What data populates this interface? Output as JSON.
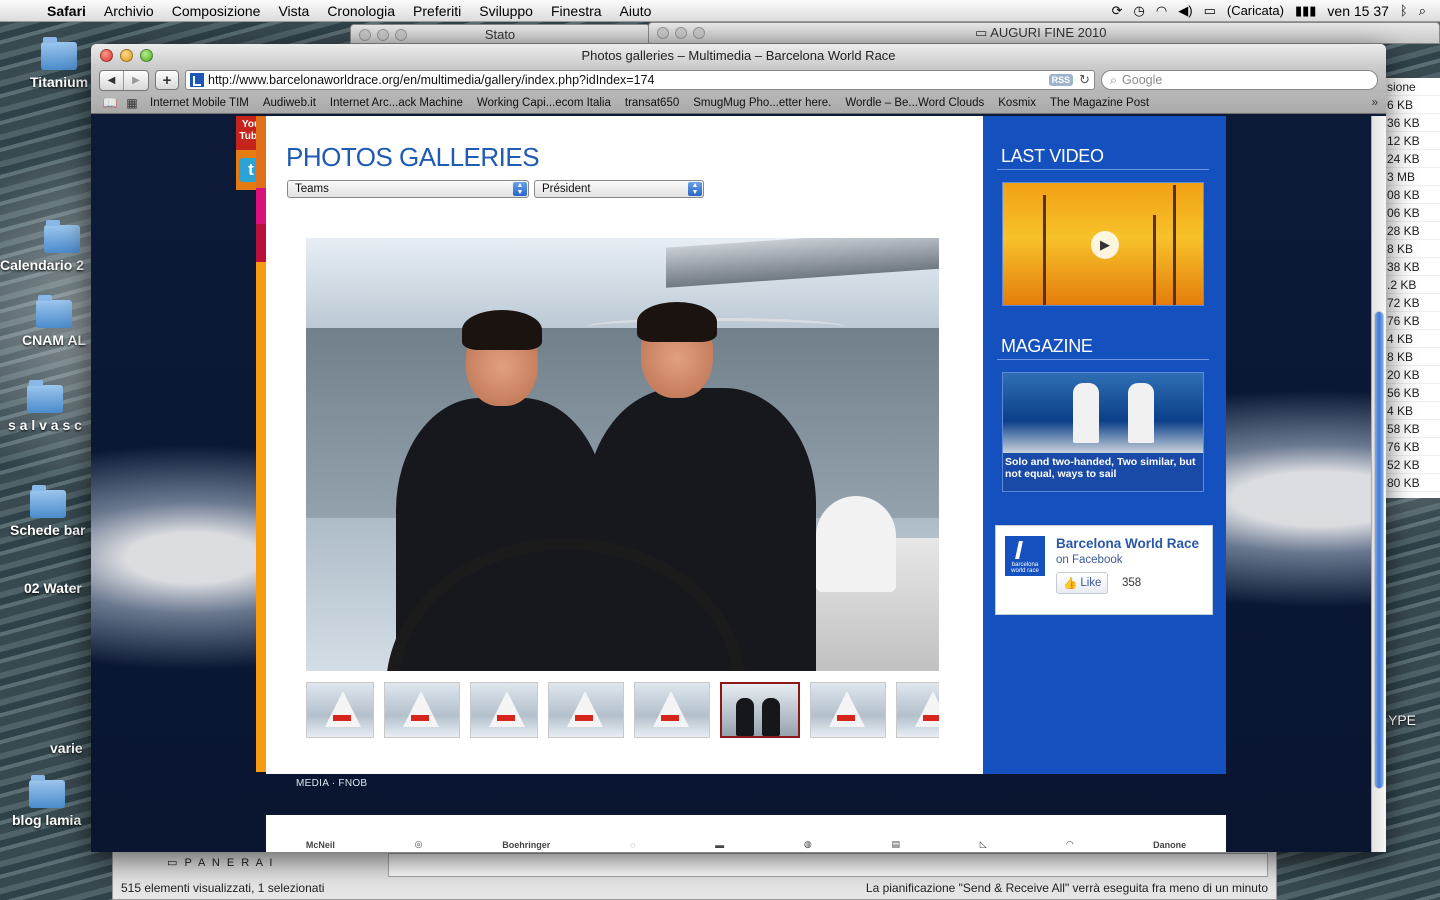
{
  "menubar": {
    "app": "Safari",
    "items": [
      "Archivio",
      "Composizione",
      "Vista",
      "Cronologia",
      "Preferiti",
      "Sviluppo",
      "Finestra",
      "Aiuto"
    ],
    "battery": "(Caricata)",
    "clock": "ven 15 37"
  },
  "desktop": {
    "icons": [
      "Titanium",
      "Calendario 2",
      "CNAM AL",
      "s a l v a s c",
      "Schede bar",
      "02 Water",
      "varie",
      "blog lamia"
    ]
  },
  "bg_windows": {
    "status_title": "Stato",
    "auguri_title": "AUGURI FINE 2010",
    "right_list_header": "sione",
    "right_list": [
      "6 KB",
      "36 KB",
      "12 KB",
      "24 KB",
      "3 MB",
      "08 KB",
      "06 KB",
      "28 KB",
      "8 KB",
      "38 KB",
      ".2 KB",
      "72 KB",
      "76 KB",
      "4 KB",
      "8 KB",
      "20 KB",
      "56 KB",
      "4 KB",
      "58 KB",
      "76 KB",
      "52 KB",
      "80 KB"
    ],
    "right_label": "YPE",
    "mail_folder": "P A N E R A I",
    "mail_status_left": "515 elementi visualizzati, 1 selezionati",
    "mail_status_right": "La pianificazione \"Send & Receive All\" verrà eseguita fra meno di un minuto"
  },
  "safari": {
    "title": "Photos galleries – Multimedia – Barcelona World Race",
    "url": "http://www.barcelonaworldrace.org/en/multimedia/gallery/index.php?idIndex=174",
    "rss": "RSS",
    "search_placeholder": "Google",
    "bookmarks": [
      "Internet Mobile TIM",
      "Audiweb.it",
      "Internet Arc...ack Machine",
      "Working Capi...ecom Italia",
      "transat650",
      "SmugMug Pho...etter here.",
      "Wordle – Be...Word Clouds",
      "Kosmix",
      "The Magazine Post"
    ]
  },
  "page": {
    "youtube_label": "You Tube",
    "twitter_label": "t",
    "heading": "PHOTOS GALLERIES",
    "select_teams": "Teams",
    "select_team_value": "Président",
    "thumbnails_count": 8,
    "active_thumbnail_index": 5,
    "side": {
      "last_video_heading": "LAST VIDEO",
      "magazine_heading": "MAGAZINE",
      "magazine_caption": "Solo and two-handed, Two similar, but not equal, ways to sail"
    },
    "facebook": {
      "logo_text": "barcelona world race",
      "title": "Barcelona World Race",
      "on": "on Facebook",
      "like": "Like",
      "count": "358"
    },
    "footer_links": "MEDIA  ·  FNOB",
    "sponsors": [
      "McNeil",
      "Boehringer",
      "Danone"
    ]
  },
  "colors": {
    "page_blue": "#1550bf",
    "heading_blue": "#1f5ab3",
    "accent_orange": "#f59c14",
    "active_thumb_border": "#8b1818"
  }
}
